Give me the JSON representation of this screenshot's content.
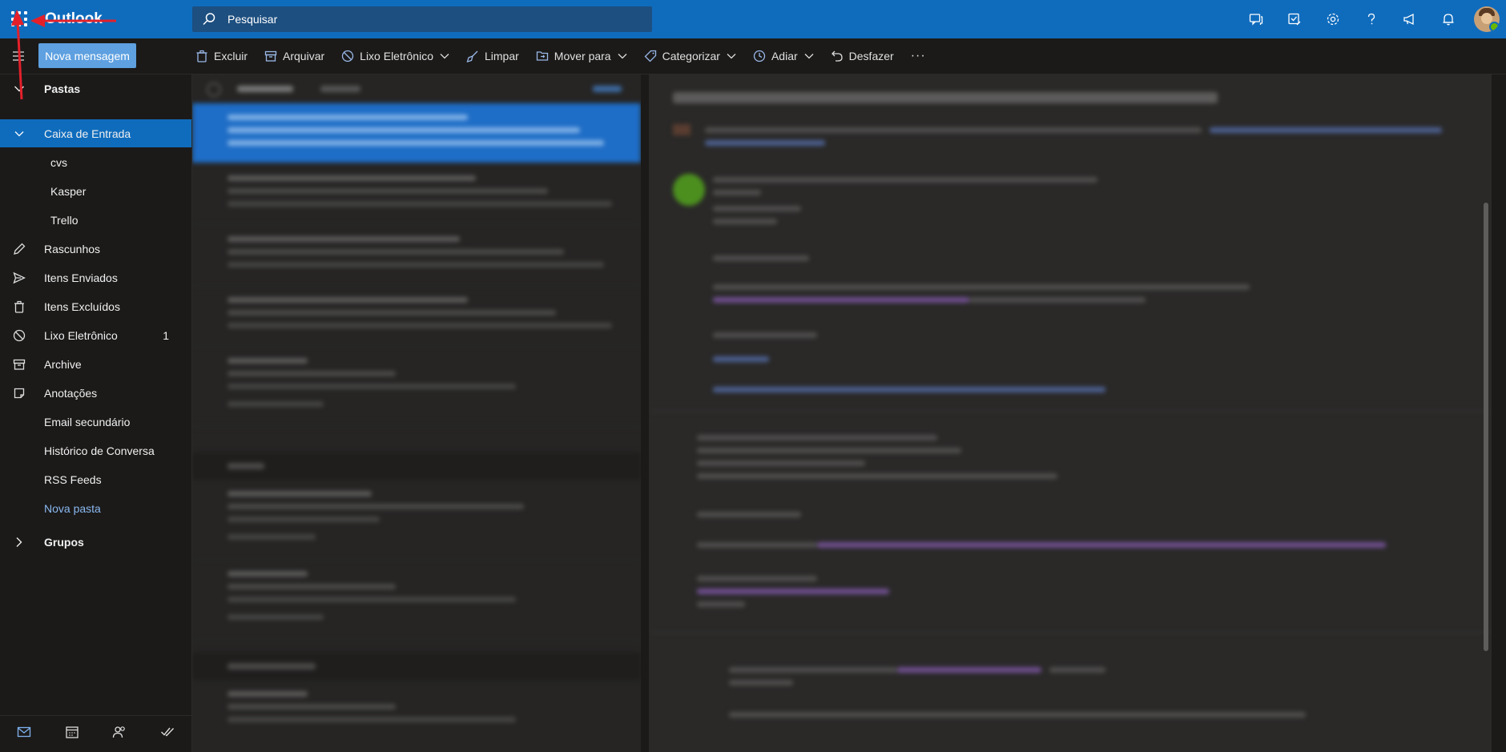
{
  "app": {
    "brand": "Outlook"
  },
  "search": {
    "placeholder": "Pesquisar"
  },
  "topbar": {
    "icons": [
      "chat-icon",
      "tasks-icon",
      "settings-icon",
      "help-icon",
      "announcement-icon",
      "bell-icon",
      "avatar"
    ]
  },
  "toolbar": {
    "new_message": "Nova mensagem",
    "delete": "Excluir",
    "archive": "Arquivar",
    "junk": "Lixo Eletrônico",
    "sweep": "Limpar",
    "move": "Mover para",
    "categorize": "Categorizar",
    "snooze": "Adiar",
    "undo": "Desfazer",
    "more": "···"
  },
  "sidebar": {
    "folders_header": "Pastas",
    "items": [
      {
        "label": "Caixa de Entrada",
        "selected": true
      },
      {
        "label": "cvs"
      },
      {
        "label": "Kasper"
      },
      {
        "label": "Trello"
      },
      {
        "label": "Rascunhos"
      },
      {
        "label": "Itens Enviados"
      },
      {
        "label": "Itens Excluídos"
      },
      {
        "label": "Lixo Eletrônico",
        "count": "1"
      },
      {
        "label": "Archive"
      },
      {
        "label": "Anotações"
      },
      {
        "label": "Email secundário"
      },
      {
        "label": "Histórico de Conversa"
      },
      {
        "label": "RSS Feeds"
      },
      {
        "label": "Nova pasta"
      }
    ],
    "groups_header": "Grupos",
    "bottom_nav": [
      "mail-icon",
      "calendar-icon",
      "people-icon",
      "todo-icon"
    ]
  },
  "colors": {
    "topbar": "#0f6cbd",
    "accent": "#0f6cbd",
    "background": "#1b1a19",
    "annotation_arrow": "#e3202a"
  }
}
